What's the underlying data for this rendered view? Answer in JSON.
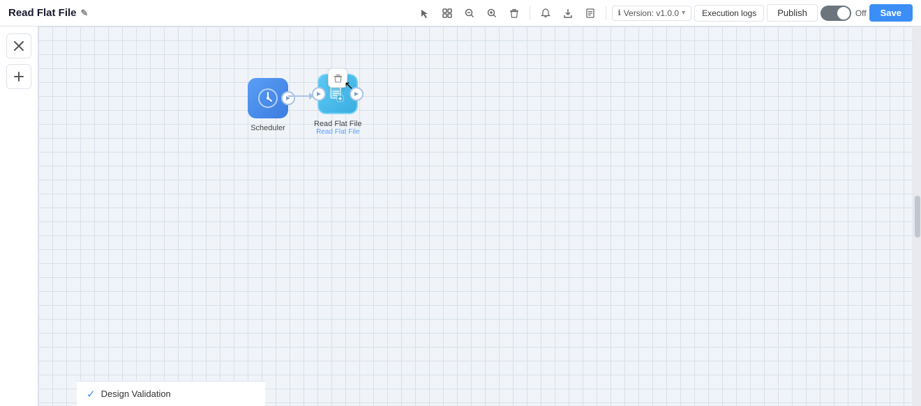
{
  "header": {
    "title": "Read Flat File",
    "edit_icon": "✎",
    "version_label": "Version: v1.0.0",
    "execution_logs_label": "Execution logs",
    "publish_label": "Publish",
    "toggle_state": "Off",
    "save_label": "Save"
  },
  "toolbar": {
    "select_icon": "✏",
    "move_icon": "⊞",
    "zoom_out_icon": "−",
    "zoom_in_icon": "+",
    "delete_icon": "🗑",
    "bell_icon": "🔔",
    "download_icon": "⬇",
    "doc_icon": "📄"
  },
  "sidebar": {
    "tools_icon": "✂",
    "add_icon": "+"
  },
  "canvas": {
    "nodes": [
      {
        "id": "scheduler",
        "label": "Scheduler",
        "sublabel": "",
        "icon": "🕐",
        "type": "scheduler"
      },
      {
        "id": "read-flat-file",
        "label": "Read Flat File",
        "sublabel": "Read Flat File",
        "icon": "📄",
        "type": "read-flat"
      }
    ]
  },
  "bottom_bar": {
    "label": "Design Validation",
    "check_icon": "✓"
  },
  "delete_popup": {
    "icon": "🗑"
  }
}
